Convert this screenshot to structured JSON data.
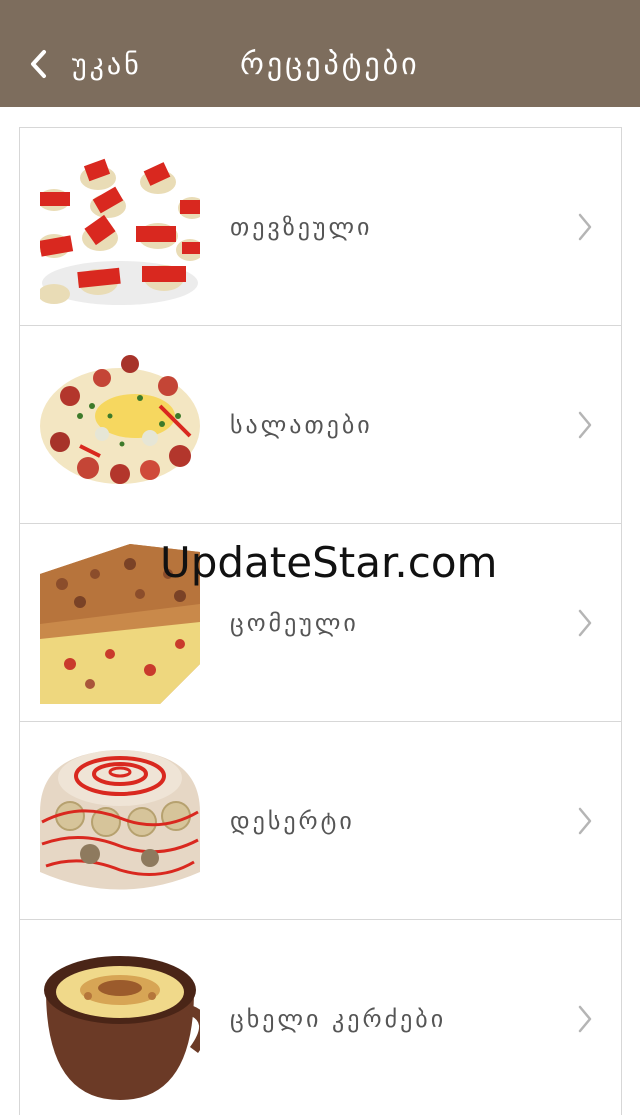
{
  "header": {
    "back_label": "უკან",
    "title": "რეცეპტები",
    "background_color": "#7d6d5d"
  },
  "categories": [
    {
      "label": "თევზეული",
      "icon": "chevron-right-icon",
      "image": "appetizer-canapes"
    },
    {
      "label": "სალათები",
      "icon": "chevron-right-icon",
      "image": "salad-plate"
    },
    {
      "label": "ცომეული",
      "icon": "chevron-right-icon",
      "image": "baked-pie"
    },
    {
      "label": "დესერტი",
      "icon": "chevron-right-icon",
      "image": "dessert-cake"
    },
    {
      "label": "ცხელი კერძები",
      "icon": "chevron-right-icon",
      "image": "clay-pot-dish"
    }
  ],
  "watermark": "UpdateStar.com"
}
